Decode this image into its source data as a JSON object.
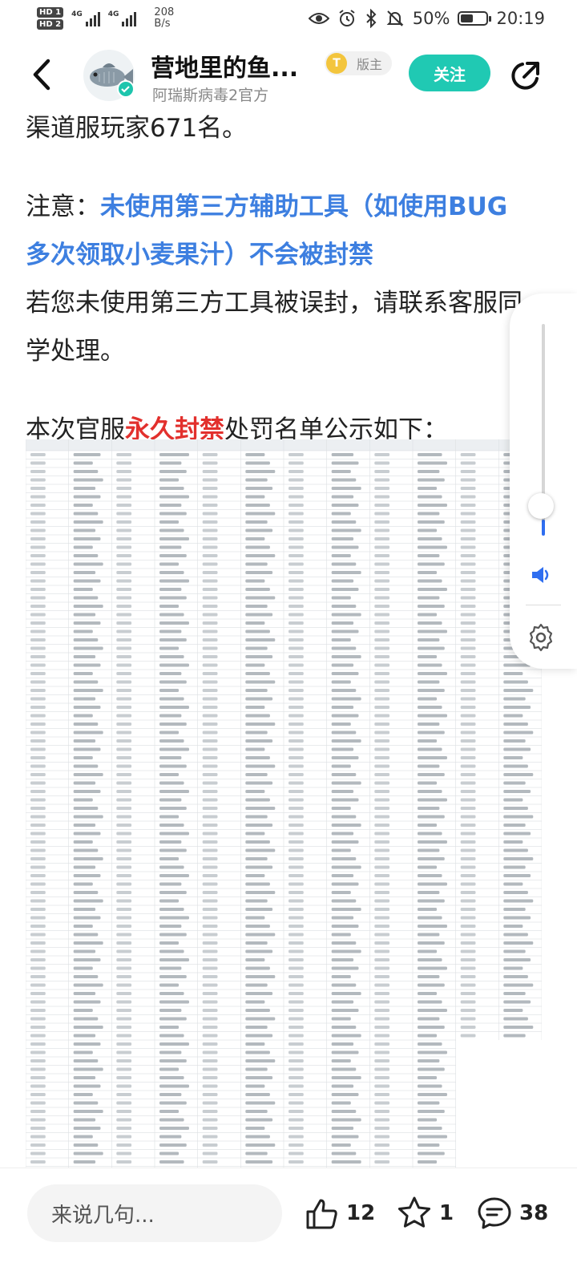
{
  "status_bar": {
    "hd1": "HD 1",
    "hd2": "HD 2",
    "network1": "4G",
    "network2": "4G",
    "net_speed_value": "208",
    "net_speed_unit": "B/s",
    "battery": "50%",
    "battery_level": 0.5,
    "time": "20:19"
  },
  "header": {
    "title": "营地里的鱼...",
    "subtitle": "阿瑞斯病毒2官方",
    "badge_coin": "T",
    "badge_label": "版主",
    "follow_label": "关注"
  },
  "article": {
    "line1": "渠道服玩家671名。",
    "notice_prefix": "注意：",
    "notice_highlight": "未使用第三方辅助工具（如使用BUG多次领取小麦果汁）不会被封禁",
    "appeal_text": "若您未使用第三方工具被误封，请联系客服同学处理。",
    "list_prefix": "本次官服",
    "list_highlight": "永久封禁",
    "list_suffix": "处罚名单公示如下："
  },
  "volume_panel": {
    "level": 0.08
  },
  "bottom_bar": {
    "comment_placeholder": "来说几句...",
    "like_count": "12",
    "favorite_count": "1",
    "comment_count": "38"
  },
  "colors": {
    "accent": "#20c9b3",
    "link_blue": "#3d7fe0",
    "alert_red": "#e2302d"
  }
}
